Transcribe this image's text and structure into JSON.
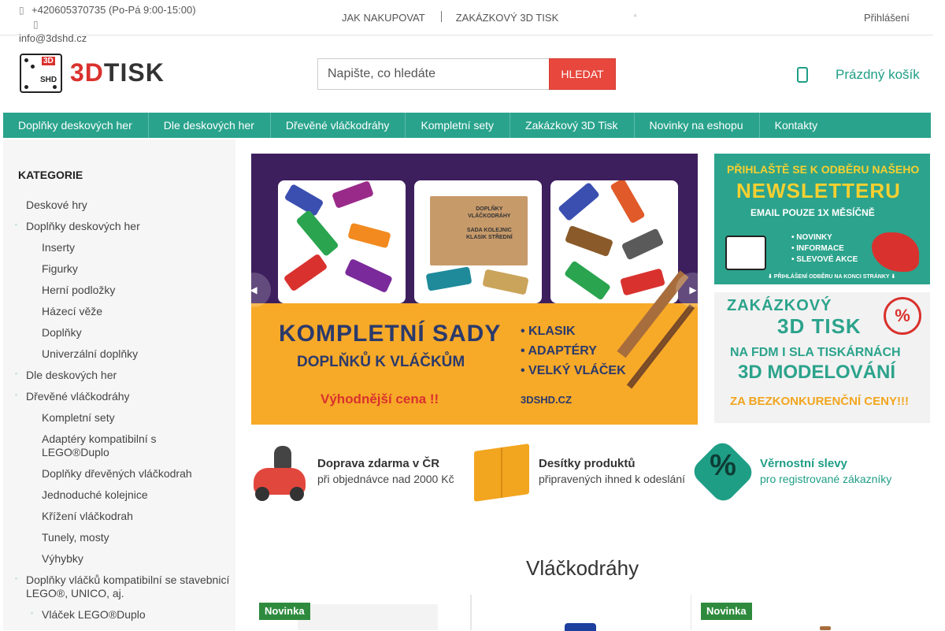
{
  "topbar": {
    "phone": "+420605370735 (Po-Pá 9:00-15:00)",
    "email": "info@3dshd.cz",
    "nav": [
      "JAK NAKUPOVAT",
      "ZAKÁZKOVÝ 3D TISK"
    ],
    "login": "Přihlášení"
  },
  "header": {
    "logo_mark": "3D",
    "logo_mark_sub": "SHD",
    "logo_text_a": "3D",
    "logo_text_b": "TISK",
    "search_placeholder": "Napište, co hledáte",
    "search_button": "HLEDAT",
    "cart_label": "Prázdný košík"
  },
  "mainnav": [
    "Doplňky deskových her",
    "Dle deskových her",
    "Dřevěné vláčkodráhy",
    "Kompletní sety",
    "Zakázkový 3D Tisk",
    "Novinky na eshopu",
    "Kontakty"
  ],
  "sidebar": {
    "title": "KATEGORIE",
    "items": [
      {
        "label": "Deskové hry",
        "level": 0,
        "bullet": false
      },
      {
        "label": "Doplňky deskových her",
        "level": 0,
        "bullet": true
      },
      {
        "label": "Inserty",
        "level": 1,
        "bullet": false
      },
      {
        "label": "Figurky",
        "level": 1,
        "bullet": false
      },
      {
        "label": "Herní podložky",
        "level": 1,
        "bullet": false
      },
      {
        "label": "Házecí věže",
        "level": 1,
        "bullet": false
      },
      {
        "label": "Doplňky",
        "level": 1,
        "bullet": false
      },
      {
        "label": "Univerzální doplňky",
        "level": 1,
        "bullet": false
      },
      {
        "label": "Dle deskových her",
        "level": 0,
        "bullet": true
      },
      {
        "label": "Dřevěné vláčkodráhy",
        "level": 0,
        "bullet": true
      },
      {
        "label": "Kompletní sety",
        "level": 1,
        "bullet": false
      },
      {
        "label": "Adaptéry kompatibilní s LEGO®Duplo",
        "level": 1,
        "bullet": false
      },
      {
        "label": "Doplňky dřevěných vláčkodrah",
        "level": 1,
        "bullet": false
      },
      {
        "label": "Jednoduché kolejnice",
        "level": 1,
        "bullet": false
      },
      {
        "label": "Křížení vláčkodrah",
        "level": 1,
        "bullet": false
      },
      {
        "label": "Tunely, mosty",
        "level": 1,
        "bullet": false
      },
      {
        "label": "Výhybky",
        "level": 1,
        "bullet": false
      },
      {
        "label": "Doplňky vláčků kompatibilní se stavebnicí LEGO®, UNICO, aj.",
        "level": 0,
        "bullet": true
      },
      {
        "label": "Vláček LEGO®Duplo",
        "level": 1,
        "bullet": true
      }
    ]
  },
  "banner": {
    "box_label_1": "DOPLŇKY",
    "box_label_2": "VLÁČKODRÁHY",
    "box_label_3": "SADA KOLEJNIC",
    "box_label_4": "KLASIK STŘEDNÍ",
    "headline": "KOMPLETNÍ SADY",
    "sub": "DOPLŇKŮ K VLÁČKŮM",
    "bullets": [
      "• KLASIK",
      "• ADAPTÉRY",
      "• VELKÝ VLÁČEK"
    ],
    "price": "Výhodnější cena !!",
    "url": "3DSHD.CZ"
  },
  "promo1": {
    "t1": "PŘIHLAŠTĚ SE K ODBĚRU NAŠEHO",
    "t2": "NEWSLETTERU",
    "t3": "EMAIL POUZE 1X MĚSÍČNĚ",
    "list": [
      "• NOVINKY",
      "• INFORMACE",
      "• SLEVOVÉ AKCE"
    ],
    "foot": "⬇ PŘIHLÁŠENÍ ODBĚRU NA KONCI STRÁNKY ⬇"
  },
  "promo2": {
    "t1": "ZAKÁZKOVÝ",
    "t2": "3D TISK",
    "t3": "NA FDM I SLA TISKÁRNÁCH",
    "t4": "3D MODELOVÁNÍ",
    "t5": "ZA BEZKONKURENČNÍ CENY!!!",
    "pct": "%"
  },
  "benefits": [
    {
      "title": "Doprava zdarma v ČR",
      "sub": "při objednávce nad 2000 Kč"
    },
    {
      "title": "Desítky produktů",
      "sub": "připravených ihned k odeslání"
    },
    {
      "title": "Věrnostní slevy",
      "sub": "pro registrované zákazníky"
    }
  ],
  "benefit3_symbol": "%",
  "section_title": "Vláčkodráhy",
  "products": [
    {
      "badge": "Novinka"
    },
    {
      "badge": ""
    },
    {
      "badge": "Novinka"
    }
  ],
  "colors": {
    "accent": "#29a38c",
    "search_button": "#e7473d",
    "badge": "#2e8b3e",
    "link": "#1f9e86"
  },
  "icons": {
    "phone": "phone-icon",
    "mail": "mail-icon",
    "cart": "cart-icon",
    "prev": "chevron-left-icon",
    "next": "chevron-right-icon"
  }
}
